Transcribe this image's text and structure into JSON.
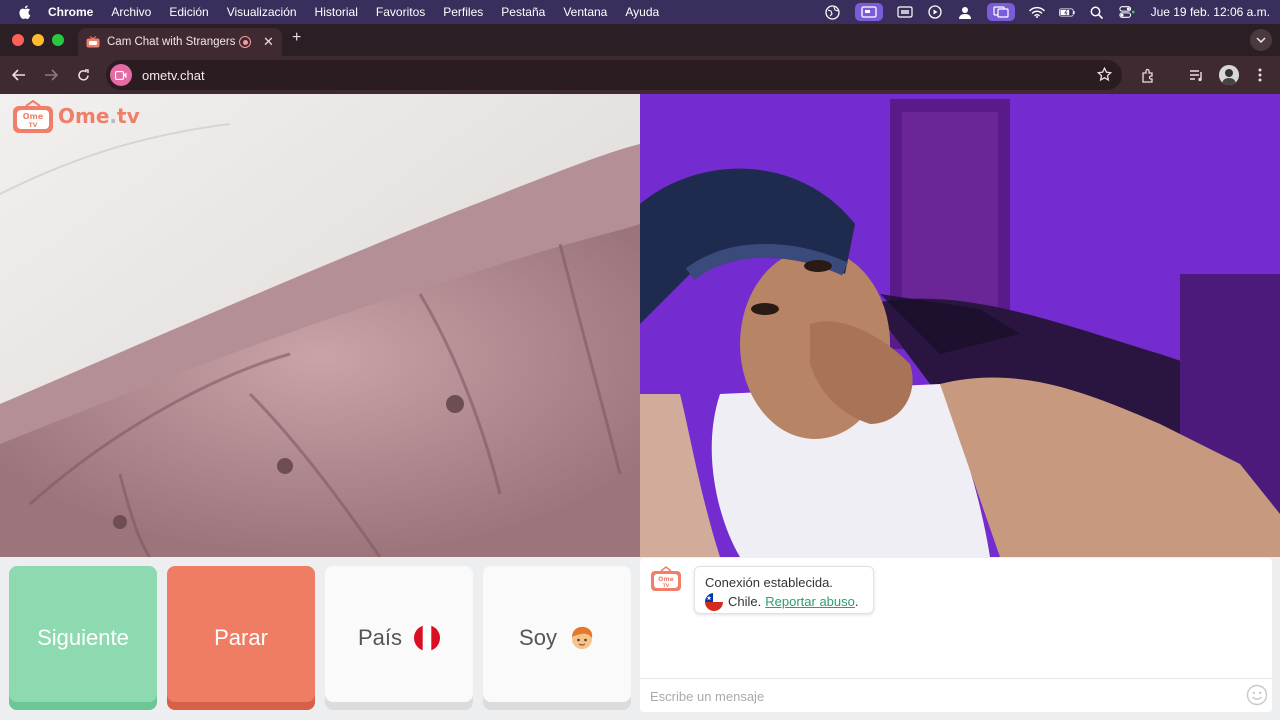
{
  "menubar": {
    "app_name": "Chrome",
    "items": [
      "Archivo",
      "Edición",
      "Visualización",
      "Historial",
      "Favoritos",
      "Perfiles",
      "Pestaña",
      "Ventana",
      "Ayuda"
    ],
    "clock": "Jue 19 feb.  12:06 a.m."
  },
  "browser": {
    "tab_title": "Cam Chat with Strangers",
    "url": "ometv.chat"
  },
  "logo": {
    "badge_top": "Ome",
    "badge_bottom": "TV",
    "brand_main": "Ome",
    "brand_dot": ".",
    "brand_tail": "tv"
  },
  "controls": {
    "next_label": "Siguiente",
    "stop_label": "Parar",
    "country_label": "País",
    "country_flag_icon": "peru-flag-icon",
    "iam_label": "Soy",
    "iam_icon": "boy-face-icon"
  },
  "chat": {
    "status_text": "Conexión establecida.",
    "country": "Chile.",
    "country_flag_icon": "chile-flag-icon",
    "report_link": "Reportar abuso",
    "report_suffix": ".",
    "input_placeholder": "Escribe un mensaje"
  },
  "colors": {
    "next_button": "#8edab0",
    "stop_button": "#ef7d64",
    "link": "#2c9f6c",
    "brand": "#f07f6a"
  }
}
